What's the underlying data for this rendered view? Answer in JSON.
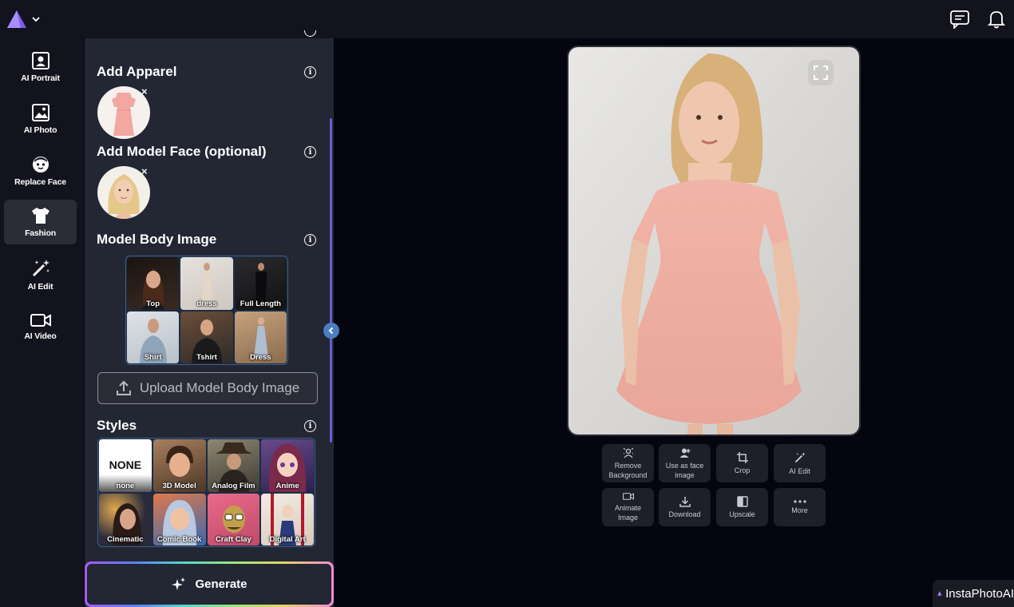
{
  "nav": {
    "items": [
      {
        "label": "AI Portrait",
        "icon": "portrait-icon"
      },
      {
        "label": "AI Photo",
        "icon": "image-icon"
      },
      {
        "label": "Replace Face",
        "icon": "face-icon"
      },
      {
        "label": "Fashion",
        "icon": "tshirt-icon",
        "active": true
      },
      {
        "label": "AI Edit",
        "icon": "magic-wand-icon"
      },
      {
        "label": "AI Video",
        "icon": "video-camera-icon"
      }
    ]
  },
  "panel": {
    "add_apparel": "Add Apparel",
    "add_model_face": "Add Model Face (optional)",
    "model_body_image": "Model Body Image",
    "body_tiles": [
      "Top",
      "dress",
      "Full Length",
      "Shirt",
      "Tshirt",
      "Dress"
    ],
    "upload_label": "Upload Model Body Image",
    "styles_title": "Styles",
    "none_tile_text": "NONE",
    "style_tiles": [
      "none",
      "3D Model",
      "Analog Film",
      "Anime",
      "Cinematic",
      "Comic Book",
      "Craft Clay",
      "Digital Art"
    ],
    "generate_label": "Generate",
    "info_glyph": "i",
    "remove_glyph": "×"
  },
  "actions": [
    {
      "label": "Remove\nBackground",
      "icon": "remove-background-icon"
    },
    {
      "label": "Use as face\nimage",
      "icon": "face-user-icon"
    },
    {
      "label": "Crop",
      "icon": "crop-icon"
    },
    {
      "label": "AI Edit",
      "icon": "magic-wand-icon"
    },
    {
      "label": "Animate\nImage",
      "icon": "video-camera-icon"
    },
    {
      "label": "Download",
      "icon": "download-icon"
    },
    {
      "label": "Upscale",
      "icon": "upscale-icon"
    },
    {
      "label": "More",
      "icon": "more-dots-icon"
    }
  ],
  "brand": {
    "text": "InstaPhotoAI"
  },
  "colors": {
    "accent": "#7b5cf0",
    "panel": "#232733",
    "background": "#05050f"
  }
}
